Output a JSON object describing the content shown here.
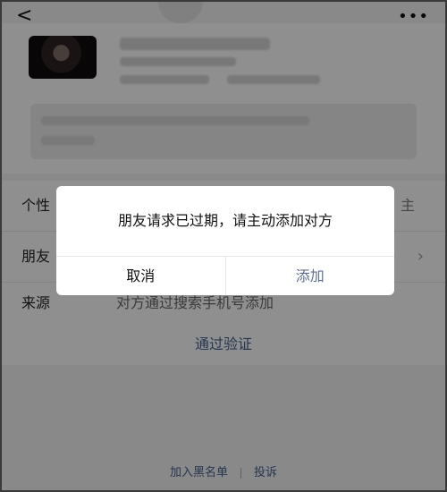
{
  "header": {
    "back_glyph": "<",
    "more_glyph": "•••"
  },
  "rows": [
    {
      "label": "个性",
      "value": "",
      "right": "主",
      "chevron": ""
    },
    {
      "label": "朋友",
      "value": "",
      "right": "",
      "chevron": "›"
    },
    {
      "label": "来源",
      "value": "对方通过搜索手机号添加",
      "right": "",
      "chevron": ""
    }
  ],
  "verify": {
    "label": "通过验证"
  },
  "footer": {
    "blacklist": "加入黑名单",
    "report": "投诉"
  },
  "dialog": {
    "message": "朋友请求已过期，请主动添加对方",
    "cancel_label": "取消",
    "confirm_label": "添加"
  },
  "colors": {
    "link": "#3f5f8a",
    "dialog_confirm": "#5b6e9a",
    "mask": "rgba(0,0,0,0.42)"
  }
}
